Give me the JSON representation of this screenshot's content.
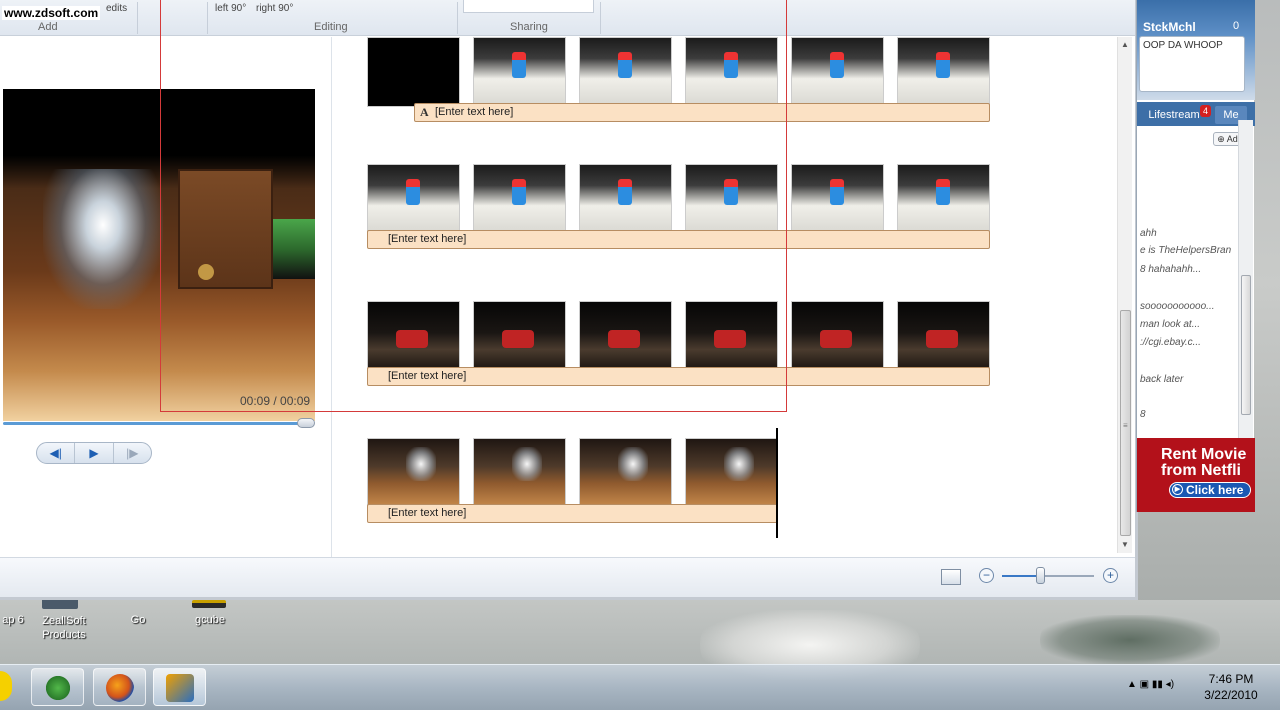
{
  "watermark": "www.zdsoft.com",
  "ribbon": {
    "top_fragments": [
      "edits",
      "left 90°",
      "right 90°"
    ],
    "groups": [
      {
        "label": "Add"
      },
      {
        "label": "Editing"
      },
      {
        "label": "Sharing"
      }
    ]
  },
  "preview": {
    "time_readout": "00:09 / 00:09",
    "controls": [
      {
        "name": "previous-frame-button",
        "glyph": "◀|"
      },
      {
        "name": "play-button",
        "glyph": "▶"
      },
      {
        "name": "next-frame-button",
        "glyph": "|▶"
      }
    ]
  },
  "storyboard": {
    "caption_placeholder": "[Enter text here]",
    "caption_icon": "A",
    "rows": [
      {
        "thumbs": [
          "black",
          "white",
          "white",
          "white",
          "white",
          "white"
        ],
        "caption": "[Enter text here]",
        "has_text_icon": true
      },
      {
        "thumbs": [
          "white",
          "white",
          "white",
          "white",
          "white",
          "white"
        ],
        "caption": "[Enter text here]",
        "has_text_icon": false
      },
      {
        "thumbs": [
          "dark",
          "dark",
          "dark",
          "dark",
          "dark",
          "dark"
        ],
        "caption": "[Enter text here]",
        "has_text_icon": false
      },
      {
        "thumbs": [
          "wood",
          "wood",
          "wood",
          "wood"
        ],
        "caption": "[Enter text here]",
        "has_text_icon": false
      }
    ]
  },
  "messenger": {
    "name": "StckMchl",
    "count": "0",
    "status": "OOP DA WHOOP",
    "tabs": [
      {
        "label": "Lifestream",
        "badge": "4"
      },
      {
        "label": "Me"
      }
    ],
    "add_label": "Add",
    "feed": [
      "ahh",
      "e is TheHelpersBran",
      "8   hahahahh...",
      "sooooooooooo...",
      "man look at...",
      "://cgi.ebay.c...",
      "back later",
      "8"
    ],
    "ad": {
      "line1": "Rent Movie",
      "line2": "from Netfli",
      "button": "Click here"
    }
  },
  "desktop_icons": [
    {
      "label": "ap 6"
    },
    {
      "label": "ZeallSoft Products"
    },
    {
      "label": "Go"
    },
    {
      "label": "gcube"
    }
  ],
  "taskbar": {
    "time": "7:46 PM",
    "date": "3/22/2010"
  }
}
